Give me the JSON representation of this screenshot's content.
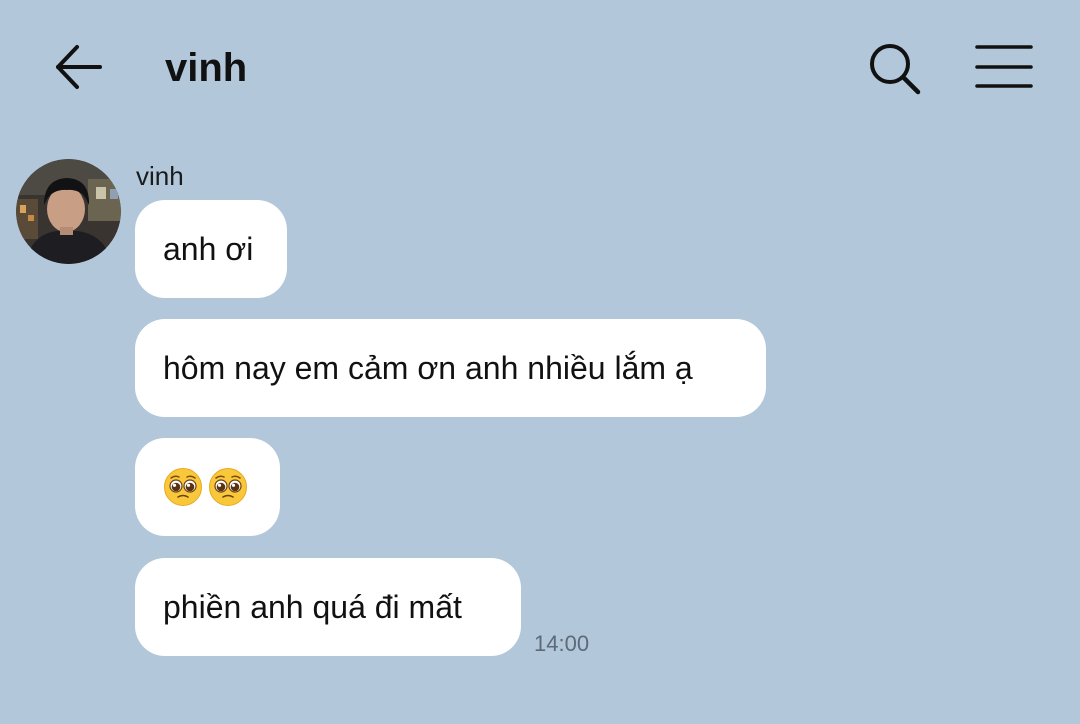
{
  "header": {
    "title": "vinh",
    "back_icon": "arrow-left-icon",
    "search_icon": "search-icon",
    "menu_icon": "hamburger-menu-icon"
  },
  "conversation": {
    "sender_name": "vinh",
    "avatar": "user-avatar-photo",
    "messages": [
      {
        "text": "anh ơi"
      },
      {
        "text": "hôm nay em cảm ơn anh nhiều lắm ạ"
      },
      {
        "emoji": "pleading-face-emoji",
        "count": 2
      },
      {
        "text": "phiền anh quá đi mất"
      }
    ],
    "last_time": "14:00"
  },
  "colors": {
    "background": "#b2c7da",
    "bubble": "#ffffff",
    "text": "#111111",
    "timestamp": "#5d6a78"
  }
}
